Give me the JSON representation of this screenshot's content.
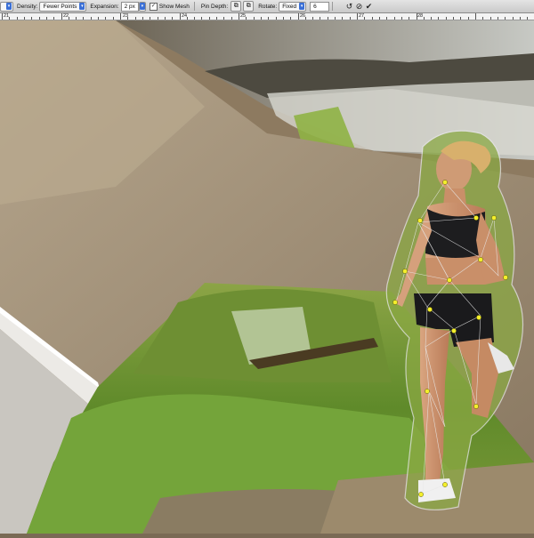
{
  "options_bar": {
    "density_label": "Density:",
    "density_value": "Fewer Points",
    "expansion_label": "Expansion:",
    "expansion_value": "2 px",
    "show_mesh_label": "Show Mesh",
    "show_mesh_checked": true,
    "pin_depth_label": "Pin Depth:",
    "rotate_label": "Rotate:",
    "rotate_value": "Fixed",
    "rotate_angle": "6",
    "buttons": [
      "reset-pins",
      "cancel",
      "commit"
    ]
  },
  "ruler": {
    "labels": [
      "21",
      "22",
      "23",
      "24",
      "25",
      "26",
      "27",
      "28"
    ]
  },
  "canvas": {
    "icons": [
      "puppet-pin-marker"
    ],
    "colors": {
      "pin": "#f4ef2c",
      "mesh": "#e6e6e6",
      "accent": "#3a6fd6"
    }
  }
}
